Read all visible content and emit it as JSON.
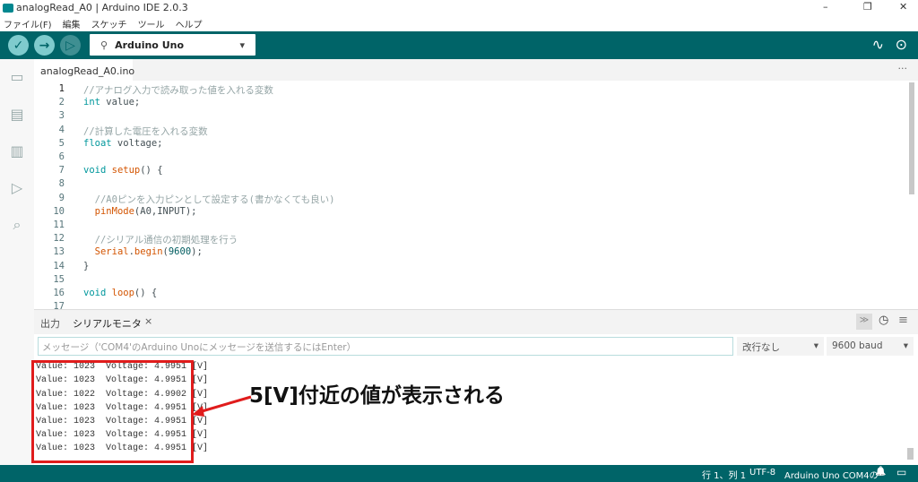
{
  "window": {
    "title": "analogRead_A0 | Arduino IDE 2.0.3",
    "minimize": "–",
    "maximize": "❐",
    "close": "✕"
  },
  "menu": [
    "ファイル(F)",
    "編集",
    "スケッチ",
    "ツール",
    "ヘルプ"
  ],
  "toolbar": {
    "verify": "✓",
    "upload": "→",
    "debug": "▷",
    "board": "Arduino Uno",
    "usb_icon": "⚲",
    "board_caret": "▾",
    "plotter": "∿",
    "monitor": "⊙"
  },
  "tab": {
    "filename": "analogRead_A0.ino",
    "more": "···"
  },
  "code": [
    [
      [
        "c",
        "//アナログ入力で読み取った値を入れる変数"
      ]
    ],
    [
      [
        "k",
        "int"
      ],
      [
        "p",
        " value;"
      ]
    ],
    [],
    [
      [
        "c",
        "//計算した電圧を入れる変数"
      ]
    ],
    [
      [
        "k",
        "float"
      ],
      [
        "p",
        " voltage;"
      ]
    ],
    [],
    [
      [
        "k",
        "void"
      ],
      [
        "p",
        " "
      ],
      [
        "f",
        "setup"
      ],
      [
        "p",
        "() {"
      ]
    ],
    [],
    [
      [
        "p",
        "  "
      ],
      [
        "c",
        "//A0ピンを入力ピンとして設定する(書かなくても良い)"
      ]
    ],
    [
      [
        "p",
        "  "
      ],
      [
        "f",
        "pinMode"
      ],
      [
        "p",
        "(A0,INPUT);"
      ]
    ],
    [],
    [
      [
        "p",
        "  "
      ],
      [
        "c",
        "//シリアル通信の初期処理を行う"
      ]
    ],
    [
      [
        "p",
        "  "
      ],
      [
        "f",
        "Serial"
      ],
      [
        "p",
        "."
      ],
      [
        "f",
        "begin"
      ],
      [
        "p",
        "("
      ],
      [
        "n",
        "9600"
      ],
      [
        "p",
        ");"
      ]
    ],
    [
      [
        "p",
        "}"
      ]
    ],
    [],
    [
      [
        "k",
        "void"
      ],
      [
        "p",
        " "
      ],
      [
        "f",
        "loop"
      ],
      [
        "p",
        "() {"
      ]
    ],
    []
  ],
  "panel": {
    "tab_output": "出力",
    "tab_serial": "シリアルモニタ",
    "close": "×",
    "autoscroll": "≫",
    "timestamp": "◷",
    "clear": "≡"
  },
  "serial": {
    "placeholder": "メッセージ（'COM4'のArduino Unoにメッセージを送信するにはEnter）",
    "line_ending": "改行なし",
    "baud": "9600 baud"
  },
  "output": [
    "Value: 1023  Voltage: 4.9951 [V]",
    "Value: 1023  Voltage: 4.9951 [V]",
    "Value: 1023  Voltage: 4.9951 [V]",
    "Value: 1022  Voltage: 4.9902 [V]",
    "Value: 1023  Voltage: 4.9951 [V]",
    "Value: 1023  Voltage: 4.9951 [V]",
    "Value: 1023  Voltage: 4.9951 [V]",
    "Value: 1023  Voltage: 4.9951 [V]"
  ],
  "status": {
    "position": "行 1、列 1",
    "encoding": "UTF-8",
    "board": "Arduino Uno COM4の",
    "bell": "🔔",
    "layout": "▭"
  },
  "annotation": {
    "text": "5[V]付近の値が表示される",
    "color": "#e01c1c"
  }
}
